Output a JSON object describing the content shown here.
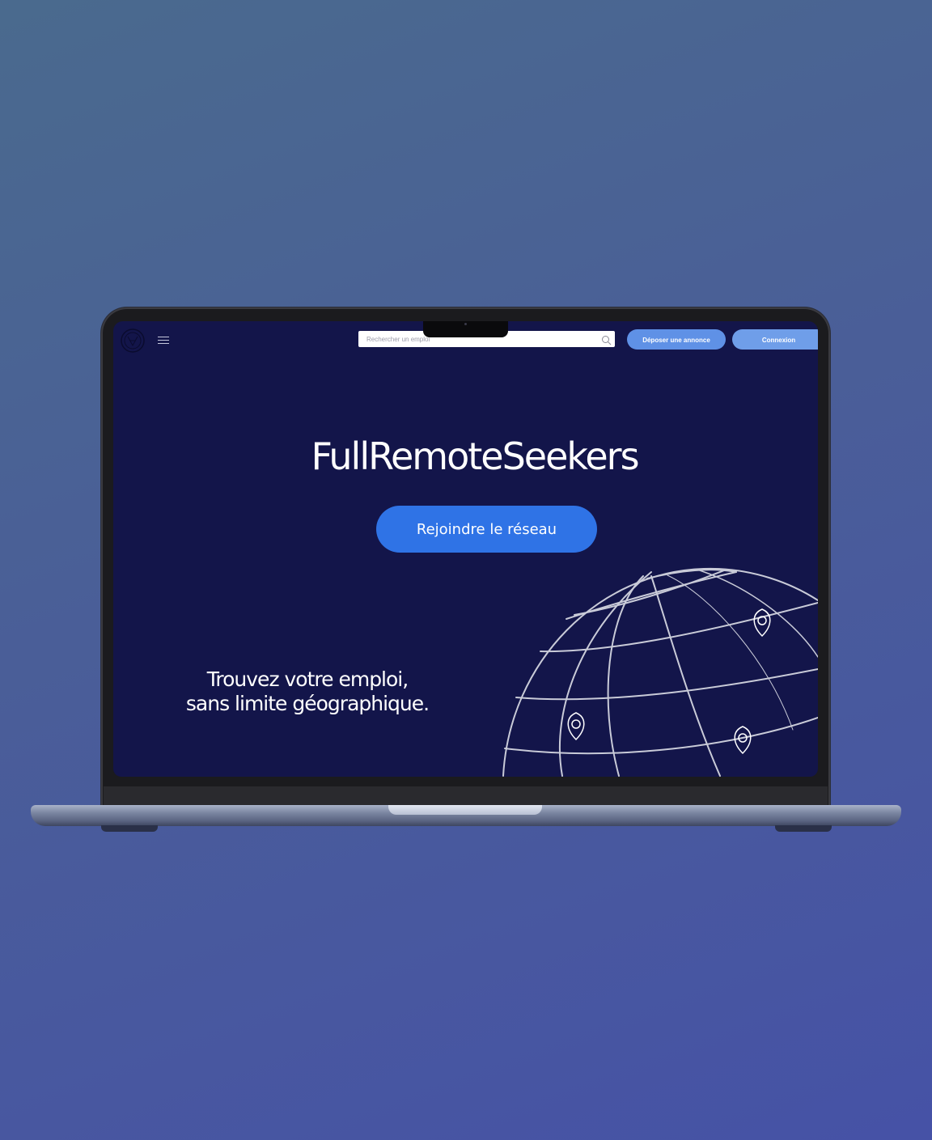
{
  "header": {
    "search": {
      "placeholder": "Rechercher un emploi"
    },
    "post_job_label": "Déposer une annonce",
    "login_label": "Connexion",
    "logo_icon": "logo-emblem-icon",
    "menu_icon": "hamburger-menu-icon"
  },
  "hero": {
    "title": "FullRemoteSeekers",
    "cta_label": "Rejoindre le réseau",
    "tagline_line1": "Trouvez votre emploi,",
    "tagline_line2": "sans limite géographique."
  },
  "colors": {
    "page_background": "#13154a",
    "button_primary": "#2f73e6",
    "button_header": "#5f91e6",
    "text": "#ffffff"
  }
}
